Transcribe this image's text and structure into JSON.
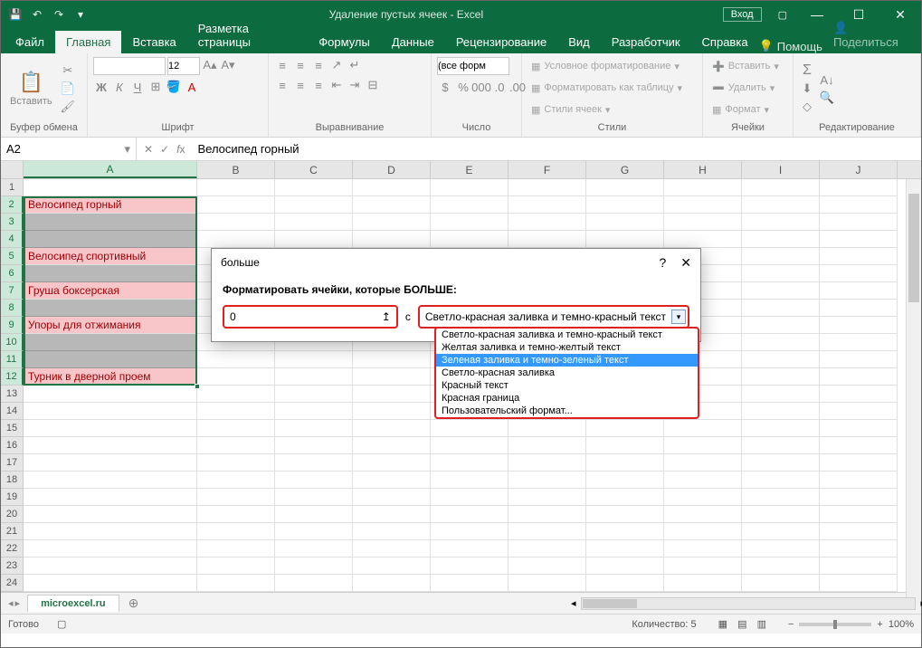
{
  "titlebar": {
    "title": "Удаление пустых ячеек  -  Excel",
    "signin": "Вход"
  },
  "tabs": {
    "file": "Файл",
    "home": "Главная",
    "insert": "Вставка",
    "layout": "Разметка страницы",
    "formulas": "Формулы",
    "data": "Данные",
    "review": "Рецензирование",
    "view": "Вид",
    "developer": "Разработчик",
    "help": "Справка",
    "tell": "Помощь",
    "share": "Поделиться"
  },
  "ribbon": {
    "paste": "Вставить",
    "clipboard": "Буфер обмена",
    "font_name": "",
    "font_size": "12",
    "font": "Шрифт",
    "alignment": "Выравнивание",
    "number_format": "(все форм",
    "number": "Число",
    "cond_format": "Условное форматирование",
    "format_table": "Форматировать как таблицу",
    "cell_styles": "Стили ячеек",
    "styles": "Стили",
    "insert_btn": "Вставить",
    "delete_btn": "Удалить",
    "format_btn": "Формат",
    "cells": "Ячейки",
    "editing": "Редактирование"
  },
  "formula": {
    "namebox": "A2",
    "value": "Велосипед горный"
  },
  "columns": [
    "A",
    "B",
    "C",
    "D",
    "E",
    "F",
    "G",
    "H",
    "I",
    "J"
  ],
  "col_widths": {
    "A": 192,
    "other": 86
  },
  "rows_shown": 24,
  "selected_rows": [
    2,
    3,
    4,
    5,
    6,
    7,
    8,
    9,
    10,
    11,
    12
  ],
  "data_rows": [
    {
      "row": 2,
      "text": "Велосипед горный",
      "fill": "red"
    },
    {
      "row": 3,
      "text": "",
      "fill": "grey"
    },
    {
      "row": 4,
      "text": "",
      "fill": "grey"
    },
    {
      "row": 5,
      "text": "Велосипед спортивный",
      "fill": "red"
    },
    {
      "row": 6,
      "text": "",
      "fill": "grey"
    },
    {
      "row": 7,
      "text": "Груша боксерская",
      "fill": "red"
    },
    {
      "row": 8,
      "text": "",
      "fill": "grey"
    },
    {
      "row": 9,
      "text": "Упоры для отжимания",
      "fill": "red"
    },
    {
      "row": 10,
      "text": "",
      "fill": "grey"
    },
    {
      "row": 11,
      "text": "",
      "fill": "grey"
    },
    {
      "row": 12,
      "text": "Турник в дверной проем",
      "fill": "red"
    }
  ],
  "dialog": {
    "title": "больше",
    "label": "Форматировать ячейки, которые БОЛЬШЕ:",
    "value": "0",
    "with": "с",
    "selected": "Светло-красная заливка и темно-красный текст",
    "options": [
      "Светло-красная заливка и темно-красный текст",
      "Желтая заливка и темно-желтый текст",
      "Зеленая заливка и темно-зеленый текст",
      "Светло-красная заливка",
      "Красный текст",
      "Красная граница",
      "Пользовательский формат..."
    ],
    "highlighted_index": 2
  },
  "sheet_tab": "microexcel.ru",
  "status": {
    "ready": "Готово",
    "count_label": "Количество:",
    "count": "5",
    "zoom": "100%"
  }
}
